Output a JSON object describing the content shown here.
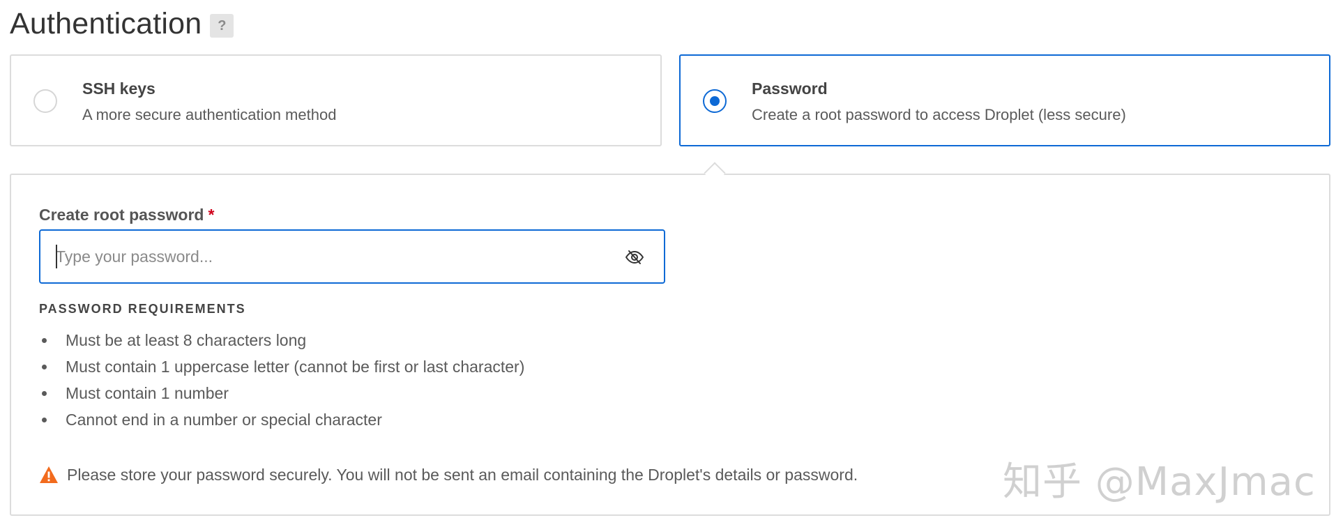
{
  "header": {
    "title": "Authentication",
    "help_label": "?"
  },
  "auth_options": [
    {
      "title": "SSH keys",
      "description": "A more secure authentication method",
      "selected": false
    },
    {
      "title": "Password",
      "description": "Create a root password to access Droplet (less secure)",
      "selected": true
    }
  ],
  "password_panel": {
    "label": "Create root password",
    "required_mark": "*",
    "input_value": "",
    "placeholder": "Type your password...",
    "visibility_icon": "eye-slash-icon",
    "requirements_heading": "PASSWORD REQUIREMENTS",
    "requirements": [
      "Must be at least 8 characters long",
      "Must contain 1 uppercase letter (cannot be first or last character)",
      "Must contain 1 number",
      "Cannot end in a number or special character"
    ],
    "warning_icon": "warning-icon",
    "warning": "Please store your password securely. You will not be sent an email containing the Droplet's details or password."
  },
  "watermark": "知乎 @MaxJmac",
  "colors": {
    "accent": "#0d69d5",
    "required": "#d0021b",
    "warning": "#f26b1d",
    "border": "#dcdcdc"
  }
}
